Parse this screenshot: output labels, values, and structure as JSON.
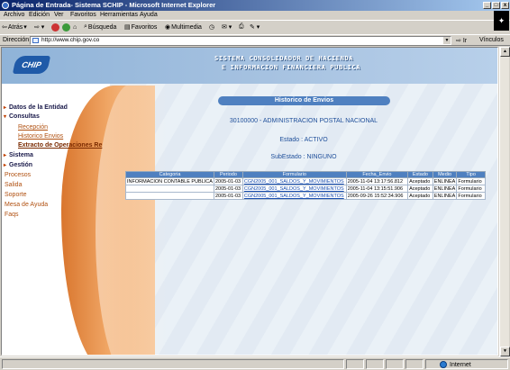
{
  "window": {
    "title": "Página de Entrada- Sistema SCHIP - Microsoft Internet Explorer",
    "controls": [
      "_",
      "□",
      "x"
    ]
  },
  "menu": [
    "Archivo",
    "Edición",
    "Ver",
    "Favoritos",
    "Herramientas",
    "Ayuda"
  ],
  "toolbar": {
    "back": "Atrás",
    "search": "Búsqueda",
    "favorites": "Favoritos",
    "multimedia": "Multimedia"
  },
  "address": {
    "label": "Dirección",
    "url": "http://www.chip.gov.co",
    "go": "Ir",
    "links": "Vínculos"
  },
  "header": {
    "logo": "CHIP",
    "line1": "SISTEMA CONSOLIDADOR DE HACIENDA",
    "line2": "E INFORMACION FINANCIERA PUBLICA"
  },
  "sidebar": {
    "datos": "Datos de la Entidad",
    "consultas": "Consultas",
    "sub1": "Recepción",
    "sub2": "Historico Envios",
    "sub3": "Extracto de Operaciones Re",
    "sistema": "Sistema",
    "gestion": "Gestión",
    "procesos": "Procesos",
    "salida": "Salida",
    "soporte": "Soporte",
    "mesa": "Mesa de Ayuda",
    "faqs": "Faqs"
  },
  "main": {
    "title": "Historico de Envios",
    "entity": "30100000 - ADMINISTRACION POSTAL NACIONAL",
    "estado": "Estado : ACTIVO",
    "subestado": "SubEstado : NINGUNO",
    "columns": [
      "Categoria",
      "Periodo",
      "Formulario",
      "Fecha_Envio",
      "Estado",
      "Medio",
      "Tipo"
    ],
    "rows": [
      {
        "categoria": "INFORMACION CONTABLE PUBLICA",
        "periodo": "2005-01-03",
        "formulario": "CGN2005_001_SALDOS_Y_MOVIMIENTOS",
        "fecha": "2005-11-04 13:17:56.812",
        "estado": "Aceptado",
        "medio": "ENLINEA",
        "tipo": "Formulario"
      },
      {
        "categoria": "",
        "periodo": "2005-01-03",
        "formulario": "CGN2005_001_SALDOS_Y_MOVIMIENTOS",
        "fecha": "2005-11-04 13:15:51.906",
        "estado": "Aceptado",
        "medio": "ENLINEA",
        "tipo": "Formulario"
      },
      {
        "categoria": "",
        "periodo": "2005-01-03",
        "formulario": "CGN2005_001_SALDOS_Y_MOVIMIENTOS",
        "fecha": "2005-09-26 15:52:34.906",
        "estado": "Aceptado",
        "medio": "ENLINEA",
        "tipo": "Formulario"
      }
    ]
  },
  "status": {
    "zone": "Internet"
  }
}
